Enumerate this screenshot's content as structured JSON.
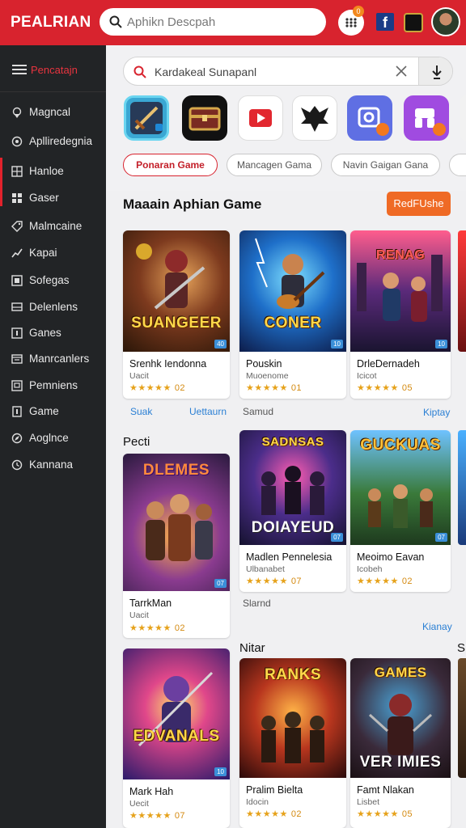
{
  "header": {
    "logo": "PEALRIAN",
    "search_placeholder": "Aphikn Descpah",
    "apps_badge": "0",
    "facebook_letter": "f"
  },
  "sidebar": {
    "title": "Pencatajn",
    "items": [
      {
        "label": "Magncal",
        "icon": "map-pin-icon"
      },
      {
        "label": "Aplliredegnia",
        "icon": "location-icon"
      },
      {
        "label": "Hanloe",
        "icon": "grid-icon"
      },
      {
        "label": "Gaser",
        "icon": "grid-icon"
      },
      {
        "label": "Malmcaine",
        "icon": "tag-icon"
      },
      {
        "label": "Kapai",
        "icon": "chart-icon"
      },
      {
        "label": "Sofegas",
        "icon": "box-icon"
      },
      {
        "label": "Delenlens",
        "icon": "monitor-icon"
      },
      {
        "label": "Ganes",
        "icon": "info-icon"
      },
      {
        "label": "Manrcanlers",
        "icon": "window-icon"
      },
      {
        "label": "Pemniens",
        "icon": "screen-icon"
      },
      {
        "label": "Game",
        "icon": "doc-icon"
      },
      {
        "label": "Aoglnce",
        "icon": "compass-icon"
      },
      {
        "label": "Kannana",
        "icon": "clock-icon"
      }
    ]
  },
  "main": {
    "search_value": "Kardakeal Sunapanl",
    "app_icons": [
      "sword-app-icon",
      "chest-app-icon",
      "play-app-icon",
      "eagle-app-icon",
      "camera-app-icon",
      "puzzle-app-icon"
    ],
    "chips": [
      "Ponaran Game",
      "Mancagen Gama",
      "Navin Gaigan Gana"
    ],
    "section1_title": "Maaain Aphian Game",
    "redfix_label": "RedFUshe",
    "row1": [
      {
        "art_title": "SUANGEER",
        "name": "Srenhk Iendonna",
        "sub": "Uacit",
        "rating": "02",
        "tag": "40"
      },
      {
        "art_title": "CONER",
        "name": "Pouskin",
        "sub": "Muoenome",
        "rating": "01",
        "tag": "10"
      },
      {
        "art_title": "RENAG",
        "name": "DrleDernadeh",
        "sub": "Icicot",
        "rating": "05",
        "tag": "10"
      }
    ],
    "row1_links": {
      "a": "Suak",
      "b": "Uettaurn",
      "c": "Samud",
      "d": "Kiptay"
    },
    "section2_title": "Pecti",
    "row2": [
      {
        "art_title": "DLEMES",
        "name": "TarrkMan",
        "sub": "Uacit",
        "rating": "02",
        "tag": "07"
      },
      {
        "art_title": "DOIAYEUD",
        "name": "Madlen Pennelesia",
        "sub": "Ulbanabet",
        "rating": "07",
        "tag": "07"
      },
      {
        "art_title": "GUCKUAS",
        "name": "Meoimo Eavan",
        "sub": "Icobeh",
        "rating": "02",
        "tag": "07"
      }
    ],
    "row2_links": {
      "a": "Slarnd",
      "b": "Kianay"
    },
    "section3_title": "Nitar",
    "section3_edge": "Sl",
    "row3": [
      {
        "art_title": "EDVANALS",
        "name": "Mark Hah",
        "sub": "Uecit",
        "rating": "07",
        "tag": "10"
      },
      {
        "art_title": "RANKS",
        "name": "Pralim Bielta",
        "sub": "Idocin",
        "rating": "02",
        "tag": ""
      },
      {
        "art_title": "VER IMIES",
        "name": "Famt Nlakan",
        "sub": "Lisbet",
        "rating": "05",
        "tag": ""
      }
    ],
    "stars": "★★★★★"
  },
  "colors": {
    "brand_red": "#d8232e",
    "sidebar_bg": "#222426",
    "accent_orange": "#ef6a25",
    "link_blue": "#2a7fd4",
    "star_gold": "#e6a21b"
  }
}
